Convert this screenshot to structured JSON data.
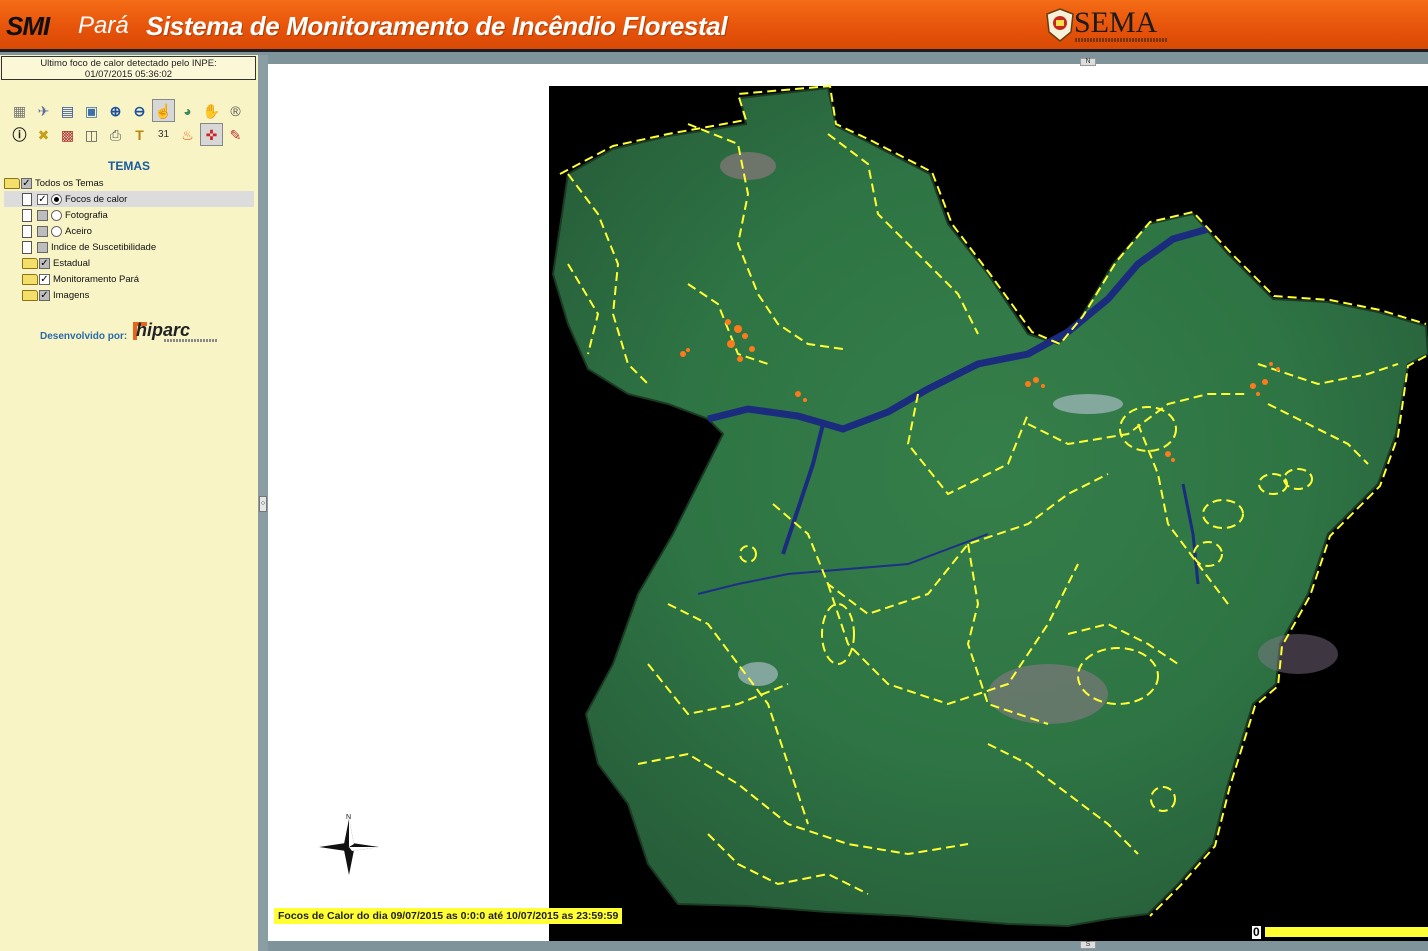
{
  "header": {
    "logo_smi": "SMI",
    "logo_para": "Pará",
    "title": "Sistema de Monitoramento de Incêndio Florestal",
    "partner_logo": "SEMA",
    "partner_seal_icon": "state-seal-icon"
  },
  "status": {
    "last_focus_label": "Ultimo foco de calor detectado pelo INPE:",
    "last_focus_time": "01/07/2015 05:36:02"
  },
  "toolbar": {
    "row1": [
      "layers-icon",
      "satellite-icon",
      "legend-icon",
      "print-map-icon",
      "zoom-in-icon",
      "zoom-out-icon",
      "pointer-icon",
      "globe-icon",
      "pan-hand-icon",
      "reset-icon"
    ],
    "row2": [
      "info-icon",
      "measure-icon",
      "grid-select-icon",
      "book-icon",
      "printer-icon",
      "text-tool-icon",
      "calendar-icon",
      "fire-icon",
      "crosshair-icon",
      "pencil-icon"
    ]
  },
  "themes": {
    "title": "TEMAS",
    "root": "Todos os Temas",
    "items": [
      {
        "label": "Focos de calor",
        "checked": true,
        "radio": true,
        "selected": true
      },
      {
        "label": "Fotografia",
        "checked": false,
        "radio": false
      },
      {
        "label": "Aceiro",
        "checked": false,
        "radio": false
      },
      {
        "label": "Indice de Suscetibilidade",
        "checked": false
      },
      {
        "label": "Estadual",
        "checked": "partial",
        "folder": true
      },
      {
        "label": "Monitoramento Pará",
        "checked": true,
        "folder": true
      },
      {
        "label": "Imagens",
        "checked": "partial",
        "folder": true
      }
    ]
  },
  "credits": {
    "developed_by": "Desenvolvido por:",
    "developer": "hiparc"
  },
  "map": {
    "date_range": "Focos de Calor do dia 09/07/2015 as 0:0:0  até 10/07/2015 as 23:59:59",
    "north_label": "N",
    "pan_north": "N",
    "pan_south": "S",
    "scale_zero": "0",
    "colors": {
      "background": "#000000",
      "forest": "#2f7a46",
      "water": "#1a2a7a",
      "boundary": "#ffff33",
      "hotspot": "#ff7a1a"
    }
  }
}
